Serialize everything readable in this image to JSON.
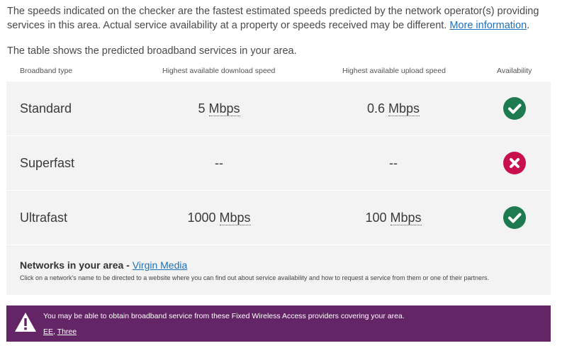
{
  "intro": {
    "text": "The speeds indicated on the checker are the fastest estimated speeds predicted by the network operator(s) providing services in this area. Actual service availability at a property or speeds received may be different. ",
    "link": "More information",
    "tail": "."
  },
  "subintro": "The table shows the predicted broadband services in your area.",
  "table": {
    "headers": {
      "type": "Broadband type",
      "download": "Highest available download speed",
      "upload": "Highest available upload speed",
      "availability": "Availability"
    },
    "rows": [
      {
        "type": "Standard",
        "download_value": "5",
        "download_unit": "Mbps",
        "upload_value": "0.6",
        "upload_unit": "Mbps",
        "available": true
      },
      {
        "type": "Superfast",
        "download_text": "--",
        "upload_text": "--",
        "available": false
      },
      {
        "type": "Ultrafast",
        "download_value": "1000",
        "download_unit": "Mbps",
        "upload_value": "100",
        "upload_unit": "Mbps",
        "available": true
      }
    ]
  },
  "networks": {
    "title": "Networks in your area - ",
    "network": "Virgin Media",
    "description": "Click on a network's name to be directed to a website where you can find out about service availability and how to request a service from them or one of their partners."
  },
  "banner": {
    "message": "You may be able to obtain broadband service from these Fixed Wireless Access providers covering your area.",
    "providers": [
      "EE",
      "Three"
    ],
    "separator": ", "
  },
  "colors": {
    "available": "#1e7a4f",
    "unavailable": "#c8104c",
    "banner": "#642567",
    "link": "#1d70b8"
  },
  "icons": {
    "available": "check-circle-icon",
    "unavailable": "cross-circle-icon",
    "banner": "warning-triangle-icon"
  }
}
